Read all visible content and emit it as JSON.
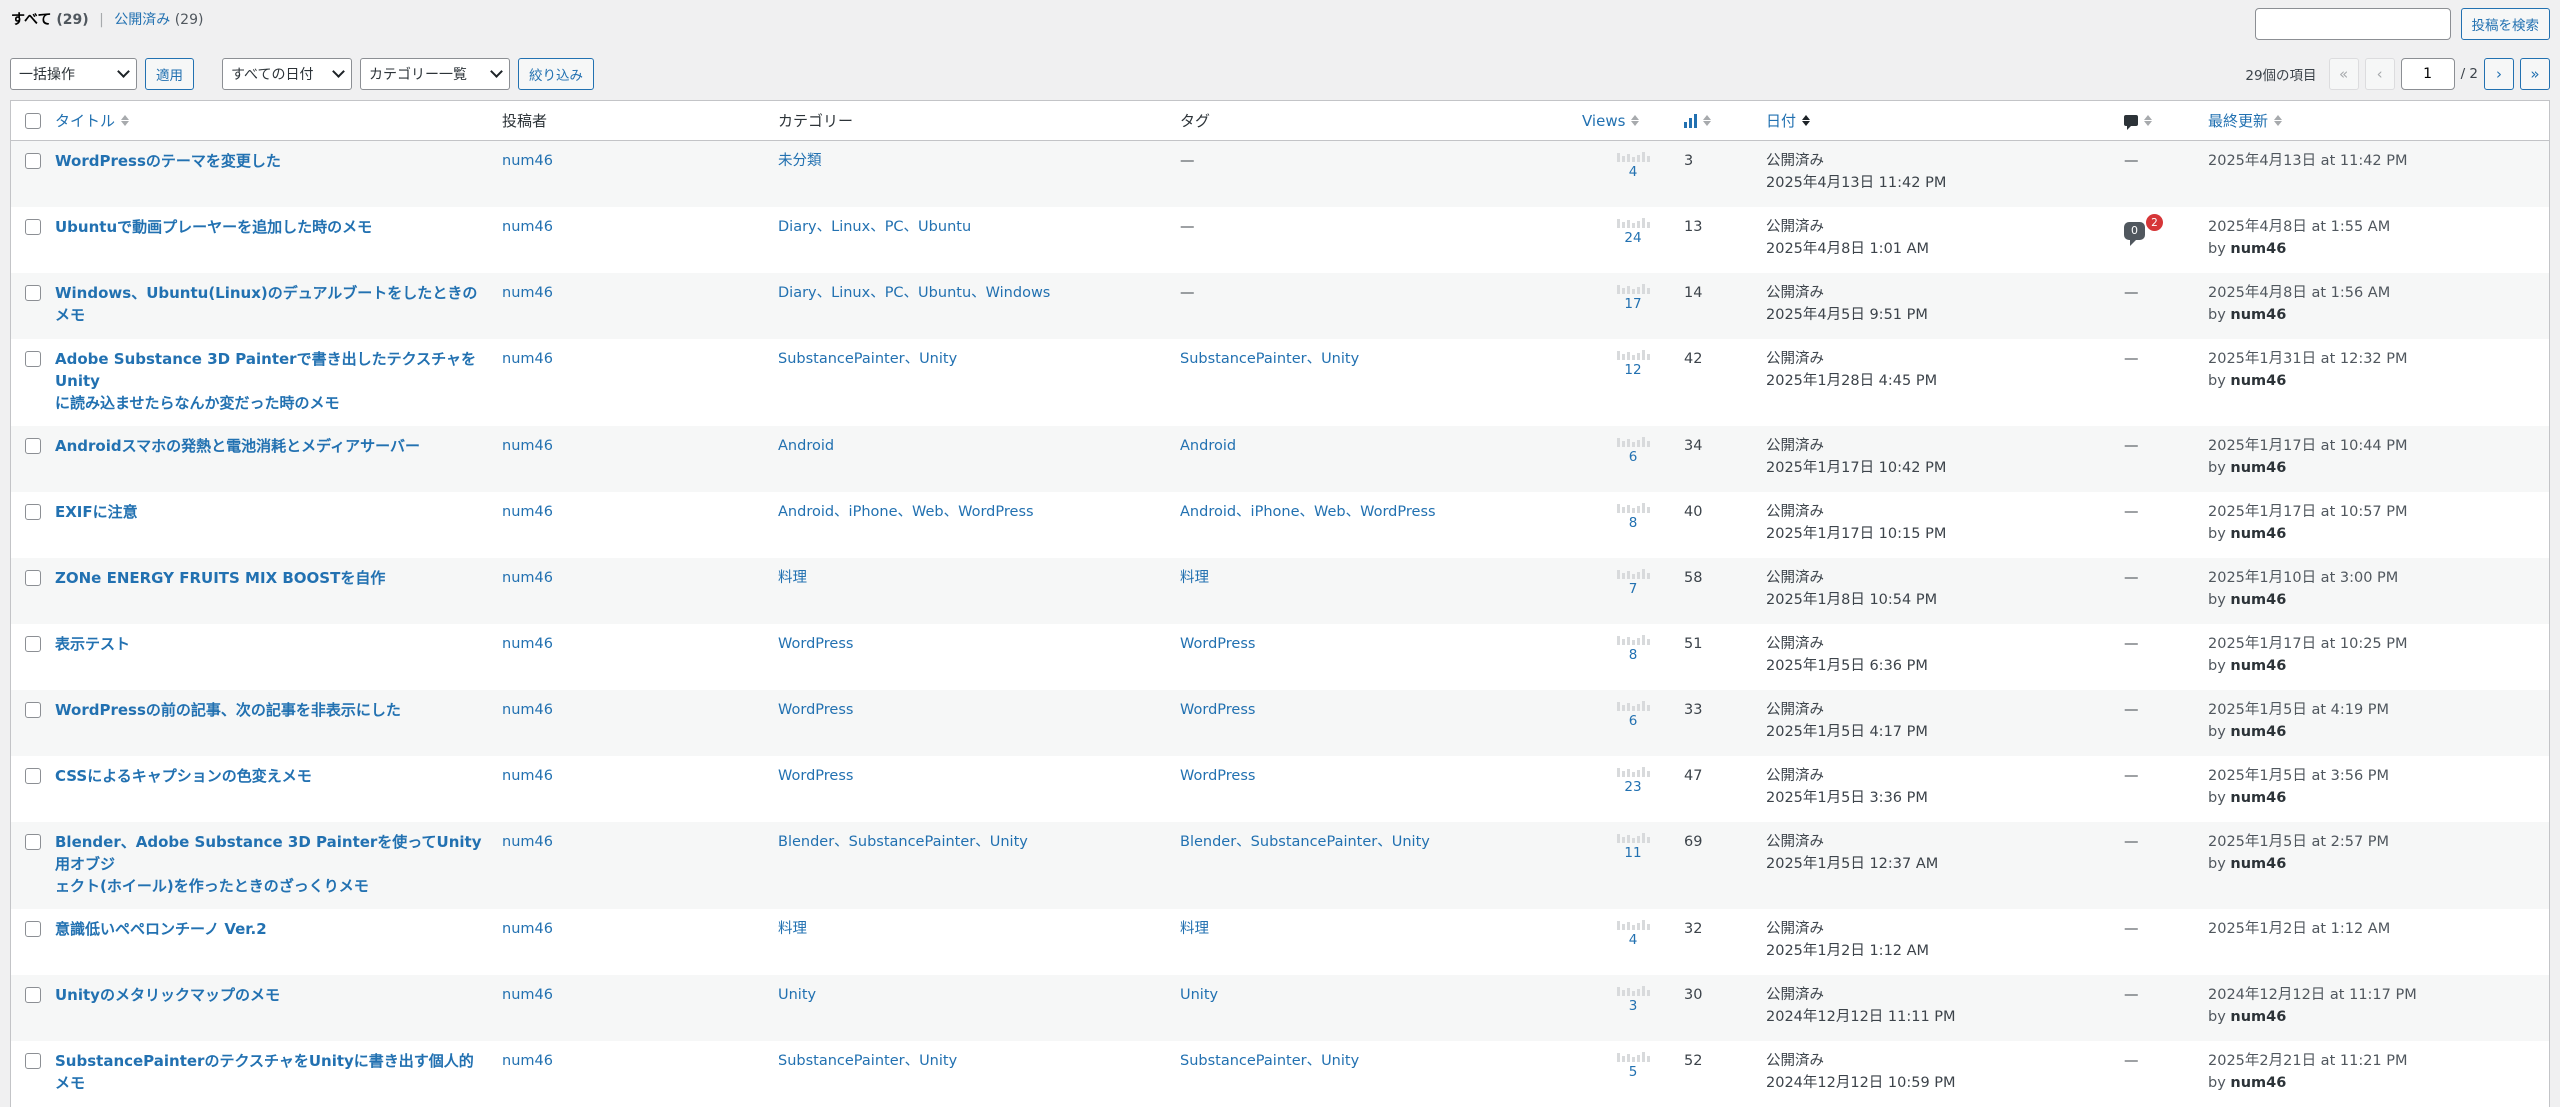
{
  "subsubsub": {
    "all_label": "すべて",
    "all_count": "(29)",
    "published_label": "公開済み",
    "published_count": "(29)",
    "separator": "|"
  },
  "search": {
    "placeholder": "",
    "button": "投稿を検索"
  },
  "tablenav": {
    "bulk_action": "一括操作",
    "apply": "適用",
    "date_filter": "すべての日付",
    "category_filter": "カテゴリー一覧",
    "filter_button": "絞り込み",
    "items_count": "29個の項目",
    "first": "«",
    "prev": "‹",
    "current_page": "1",
    "total_pages": "/ 2",
    "next": "›",
    "last": "»"
  },
  "columns": {
    "title": "タイトル",
    "author": "投稿者",
    "categories": "カテゴリー",
    "tags": "タグ",
    "views": "Views",
    "date": "日付",
    "modified": "最終更新"
  },
  "posts": [
    {
      "title": [
        "WordPressのテーマを変更した"
      ],
      "author": "num46",
      "categories": "未分類",
      "tags": "—",
      "views": "4",
      "count": "3",
      "status": "公開済み",
      "date": "2025年4月13日 11:42 PM",
      "comments": "—",
      "modified": "2025年4月13日 at 11:42 PM",
      "by_prefix": "",
      "by": ""
    },
    {
      "title": [
        "Ubuntuで動画プレーヤーを追加した時のメモ"
      ],
      "author": "num46",
      "categories": "Diary、Linux、PC、Ubuntu",
      "tags": "—",
      "views": "24",
      "count": "13",
      "status": "公開済み",
      "date": "2025年4月8日 1:01 AM",
      "comments": "0",
      "pending": "2",
      "modified": "2025年4月8日 at 1:55 AM",
      "by_prefix": "by",
      "by": "num46"
    },
    {
      "title": [
        "Windows、Ubuntu(Linux)のデュアルブートをしたときのメモ"
      ],
      "author": "num46",
      "categories": "Diary、Linux、PC、Ubuntu、Windows",
      "tags": "—",
      "views": "17",
      "count": "14",
      "status": "公開済み",
      "date": "2025年4月5日 9:51 PM",
      "comments": "—",
      "modified": "2025年4月8日 at 1:56 AM",
      "by_prefix": "by",
      "by": "num46"
    },
    {
      "title": [
        "Adobe Substance 3D Painterで書き出したテクスチャをUnity",
        "に読み込ませたらなんか変だった時のメモ"
      ],
      "author": "num46",
      "categories": "SubstancePainter、Unity",
      "tags": "SubstancePainter、Unity",
      "views": "12",
      "count": "42",
      "status": "公開済み",
      "date": "2025年1月28日 4:45 PM",
      "comments": "—",
      "modified": "2025年1月31日 at 12:32 PM",
      "by_prefix": "by",
      "by": "num46"
    },
    {
      "title": [
        "Androidスマホの発熱と電池消耗とメディアサーバー"
      ],
      "author": "num46",
      "categories": "Android",
      "tags": "Android",
      "views": "6",
      "count": "34",
      "status": "公開済み",
      "date": "2025年1月17日 10:42 PM",
      "comments": "—",
      "modified": "2025年1月17日 at 10:44 PM",
      "by_prefix": "by",
      "by": "num46"
    },
    {
      "title": [
        "EXIFに注意"
      ],
      "author": "num46",
      "categories": "Android、iPhone、Web、WordPress",
      "tags": "Android、iPhone、Web、WordPress",
      "views": "8",
      "count": "40",
      "status": "公開済み",
      "date": "2025年1月17日 10:15 PM",
      "comments": "—",
      "modified": "2025年1月17日 at 10:57 PM",
      "by_prefix": "by",
      "by": "num46"
    },
    {
      "title": [
        "ZONe ENERGY FRUITS MIX BOOSTを自作"
      ],
      "author": "num46",
      "categories": "料理",
      "tags": "料理",
      "views": "7",
      "count": "58",
      "status": "公開済み",
      "date": "2025年1月8日 10:54 PM",
      "comments": "—",
      "modified": "2025年1月10日 at 3:00 PM",
      "by_prefix": "by",
      "by": "num46"
    },
    {
      "title": [
        "表示テスト"
      ],
      "author": "num46",
      "categories": "WordPress",
      "tags": "WordPress",
      "views": "8",
      "count": "51",
      "status": "公開済み",
      "date": "2025年1月5日 6:36 PM",
      "comments": "—",
      "modified": "2025年1月17日 at 10:25 PM",
      "by_prefix": "by",
      "by": "num46"
    },
    {
      "title": [
        "WordPressの前の記事、次の記事を非表示にした"
      ],
      "author": "num46",
      "categories": "WordPress",
      "tags": "WordPress",
      "views": "6",
      "count": "33",
      "status": "公開済み",
      "date": "2025年1月5日 4:17 PM",
      "comments": "—",
      "modified": "2025年1月5日 at 4:19 PM",
      "by_prefix": "by",
      "by": "num46"
    },
    {
      "title": [
        "CSSによるキャプションの色変えメモ"
      ],
      "author": "num46",
      "categories": "WordPress",
      "tags": "WordPress",
      "views": "23",
      "count": "47",
      "status": "公開済み",
      "date": "2025年1月5日 3:36 PM",
      "comments": "—",
      "modified": "2025年1月5日 at 3:56 PM",
      "by_prefix": "by",
      "by": "num46"
    },
    {
      "title": [
        "Blender、Adobe Substance 3D Painterを使ってUnity用オブジ",
        "ェクト(ホイール)を作ったときのざっくりメモ"
      ],
      "author": "num46",
      "categories": "Blender、SubstancePainter、Unity",
      "tags": "Blender、SubstancePainter、Unity",
      "views": "11",
      "count": "69",
      "status": "公開済み",
      "date": "2025年1月5日 12:37 AM",
      "comments": "—",
      "modified": "2025年1月5日 at 2:57 PM",
      "by_prefix": "by",
      "by": "num46"
    },
    {
      "title": [
        "意識低いペペロンチーノ Ver.2"
      ],
      "author": "num46",
      "categories": "料理",
      "tags": "料理",
      "views": "4",
      "count": "32",
      "status": "公開済み",
      "date": "2025年1月2日 1:12 AM",
      "comments": "—",
      "modified": "2025年1月2日 at 1:12 AM",
      "by_prefix": "",
      "by": ""
    },
    {
      "title": [
        "Unityのメタリックマップのメモ"
      ],
      "author": "num46",
      "categories": "Unity",
      "tags": "Unity",
      "views": "3",
      "count": "30",
      "status": "公開済み",
      "date": "2024年12月12日 11:11 PM",
      "comments": "—",
      "modified": "2024年12月12日 at 11:17 PM",
      "by_prefix": "by",
      "by": "num46"
    },
    {
      "title": [
        "SubstancePainterのテクスチャをUnityに書き出す個人的メモ"
      ],
      "author": "num46",
      "categories": "SubstancePainter、Unity",
      "tags": "SubstancePainter、Unity",
      "views": "5",
      "count": "52",
      "status": "公開済み",
      "date": "2024年12月12日 10:59 PM",
      "comments": "—",
      "modified": "2025年2月21日 at 11:21 PM",
      "by_prefix": "by",
      "by": "num46"
    }
  ],
  "colors": {
    "link": "#2271b1",
    "background": "#f0f0f1",
    "pending_badge": "#d63638"
  }
}
